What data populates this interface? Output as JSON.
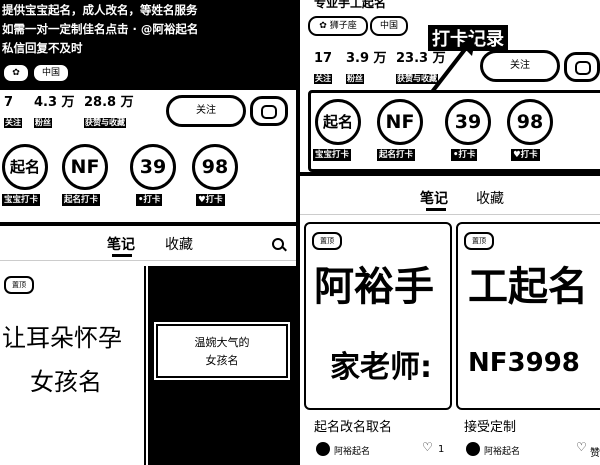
{
  "profile_left": {
    "bio_lines": [
      "提供宝宝起名，成人改名，等姓名服务",
      "如需一对一定制佳名点击 · @阿裕起名",
      "私信回复不及时"
    ],
    "tags": [
      "✿",
      "中国"
    ],
    "stats": [
      {
        "value": "7",
        "label": "关注"
      },
      {
        "value": "4.3 万",
        "label": "粉丝"
      },
      {
        "value": "28.8 万",
        "label": "获赞与收藏"
      }
    ],
    "follow_label": "关注",
    "badges": [
      {
        "text": "起名",
        "label": "宝宝打卡"
      },
      {
        "text": "NF",
        "label": "起名打卡"
      },
      {
        "text": "39",
        "label": "•打卡"
      },
      {
        "text": "98",
        "label": "♥打卡"
      }
    ]
  },
  "profile_right": {
    "top_title": "专业手工起名",
    "tags": [
      "✿ 狮子座",
      "中国"
    ],
    "annotation": "打卡记录",
    "stats": [
      {
        "value": "17",
        "label": "关注"
      },
      {
        "value": "3.9 万",
        "label": "粉丝"
      },
      {
        "value": "23.3 万",
        "label": "获赞与收藏"
      }
    ],
    "follow_label": "关注",
    "badges": [
      {
        "text": "起名",
        "label": "宝宝打卡"
      },
      {
        "text": "NF",
        "label": "起名打卡"
      },
      {
        "text": "39",
        "label": "•打卡"
      },
      {
        "text": "98",
        "label": "♥打卡"
      }
    ]
  },
  "feed_left": {
    "tabs": [
      "笔记",
      "收藏"
    ],
    "corner_chip": "置顶",
    "card1_lines": [
      "让耳朵怀孕",
      "女孩名"
    ],
    "card2_lines": [
      "温婉大气的",
      "女孩名"
    ]
  },
  "feed_right": {
    "tabs": [
      "笔记",
      "收藏"
    ],
    "corner_chip": "置顶",
    "cards": [
      {
        "line1": "阿裕手",
        "line2": "家老师:",
        "caption": "起名改名取名",
        "author": "阿裕起名",
        "likes": "1"
      },
      {
        "line1": "工起名",
        "line2": "NF3998",
        "caption": "接受定制",
        "author": "阿裕起名",
        "likes": "赞"
      }
    ]
  }
}
